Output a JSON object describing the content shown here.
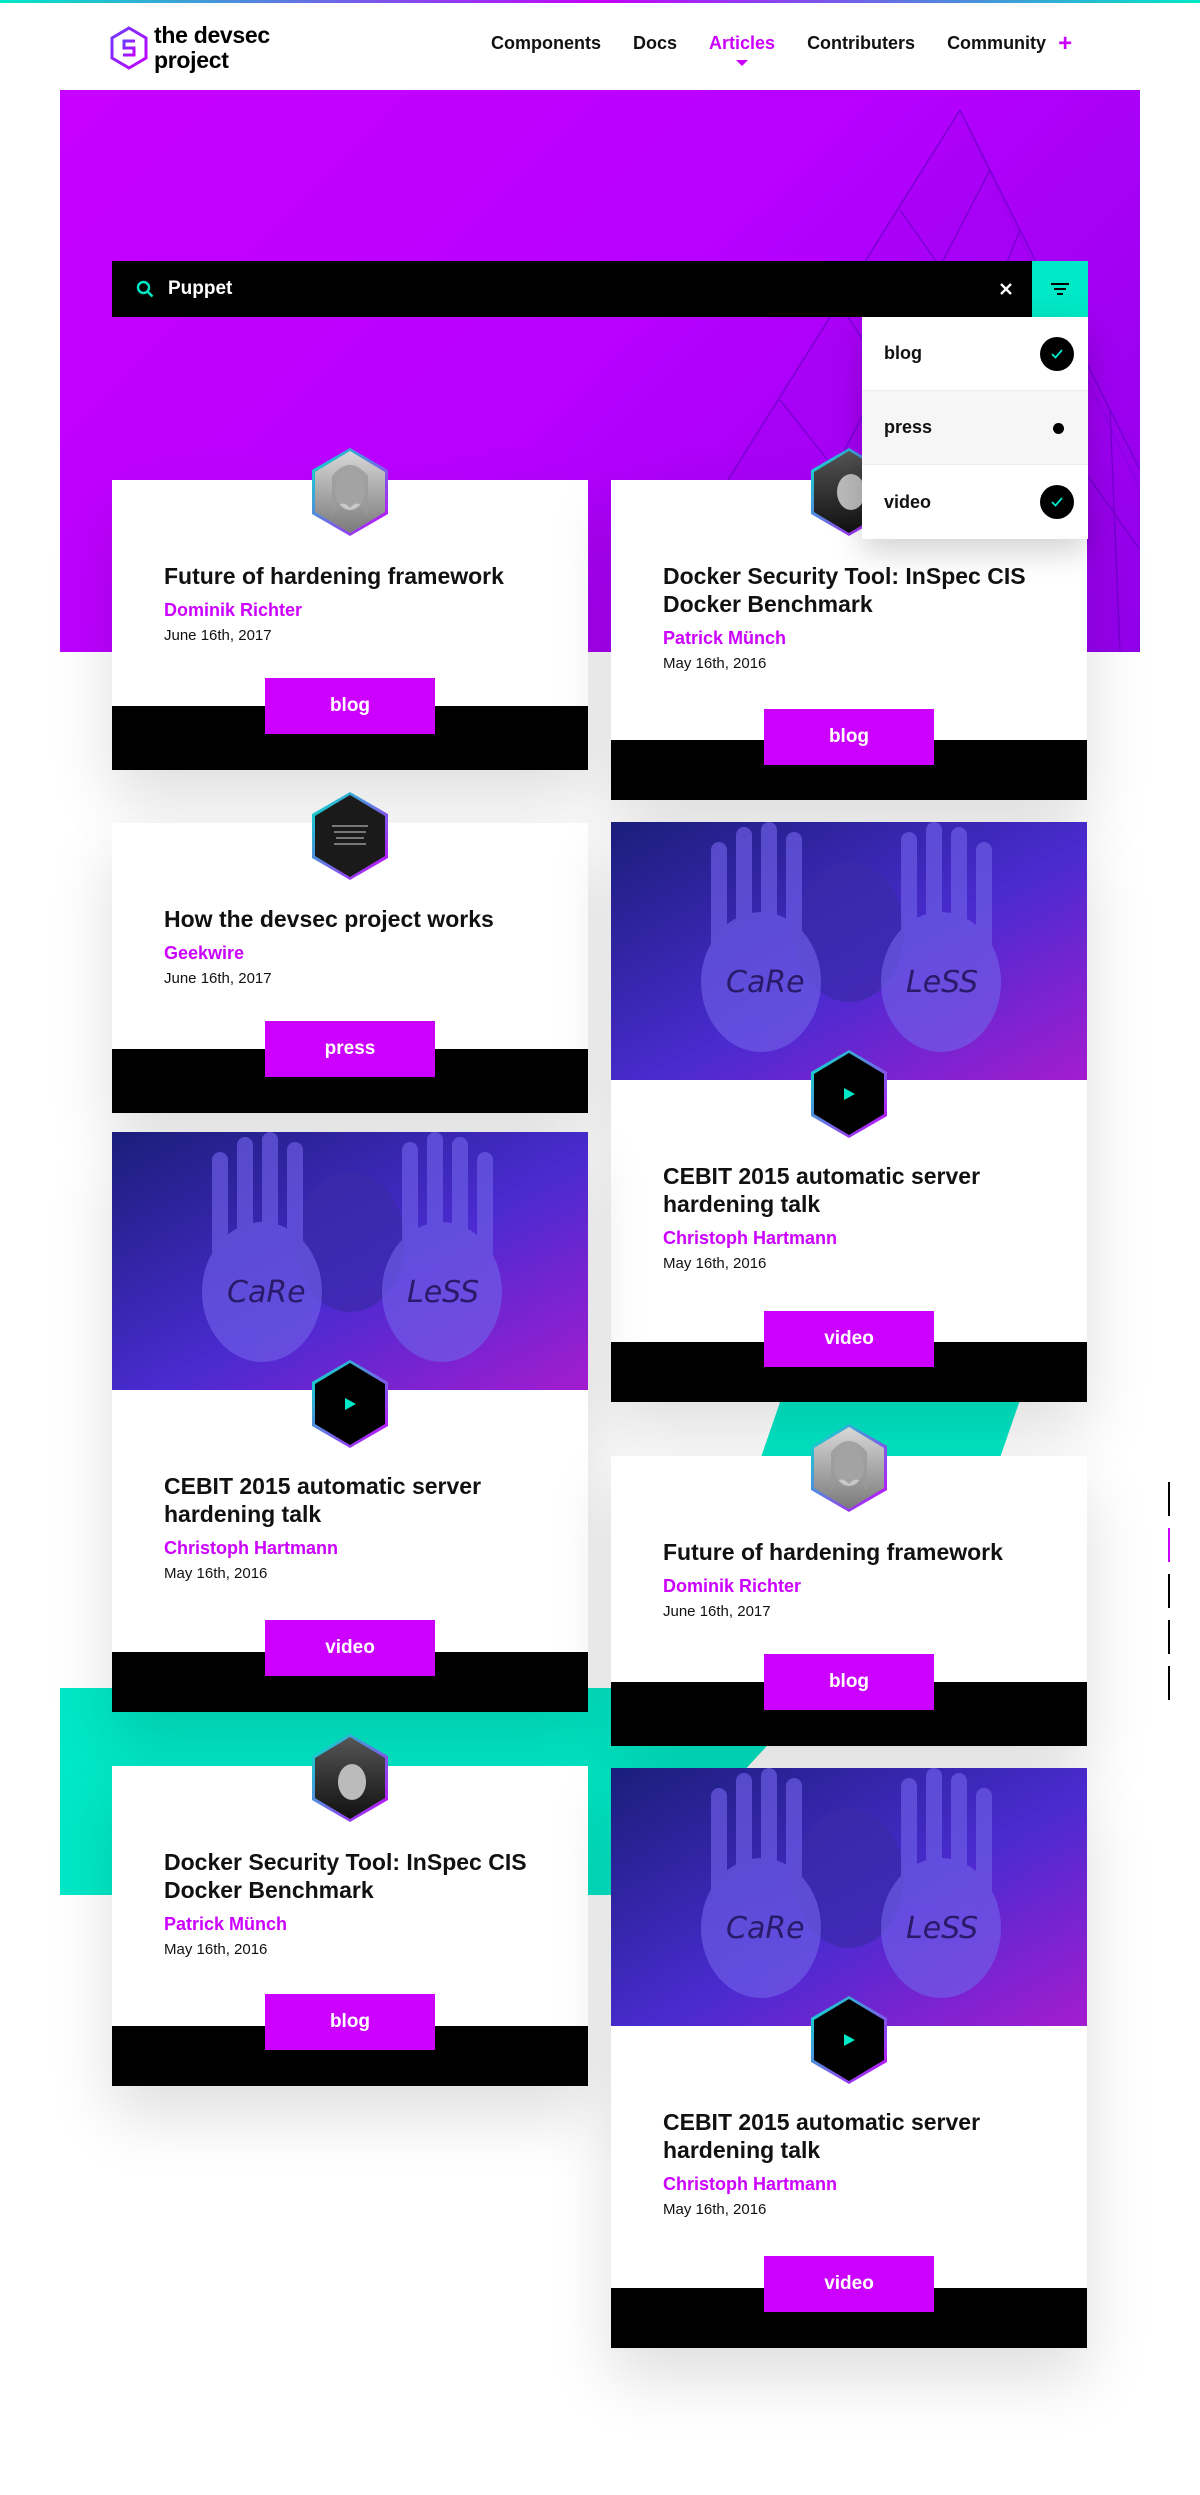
{
  "brand": {
    "name_line1": "the devsec",
    "name_line2": "project",
    "accent": "#cc00ff",
    "teal": "#00e8c6"
  },
  "nav": {
    "items": [
      "Components",
      "Docs",
      "Articles",
      "Contributers",
      "Community"
    ],
    "active": "Articles",
    "plus": "+"
  },
  "search": {
    "value": "Puppet",
    "icon": "search-icon",
    "clear_icon": "close-icon",
    "filter_icon": "filter-icon"
  },
  "filter_menu": {
    "items": [
      {
        "label": "blog",
        "checked": true
      },
      {
        "label": "press",
        "checked": false
      },
      {
        "label": "video",
        "checked": true
      }
    ]
  },
  "cards": [
    {
      "title": "Future of hardening framework",
      "author": "Dominik Richter",
      "date": "June 16th, 2017",
      "tag": "blog"
    },
    {
      "title": "Docker Security Tool: InSpec CIS Docker Benchmark",
      "author": "Patrick Münch",
      "date": "May 16th, 2016",
      "tag": "blog"
    },
    {
      "title": "How the devsec project works",
      "author": "Geekwire",
      "date": "June 16th, 2017",
      "tag": "press"
    },
    {
      "title": "CEBIT 2015 automatic server hardening talk",
      "author": "Christoph Hartmann",
      "date": "May 16th, 2016",
      "tag": "video",
      "image_text_left": "CaRe",
      "image_text_right": "LeSS"
    },
    {
      "title": "CEBIT 2015 automatic server hardening talk",
      "author": "Christoph Hartmann",
      "date": "May 16th, 2016",
      "tag": "video",
      "image_text_left": "CaRe",
      "image_text_right": "LeSS"
    },
    {
      "title": "Future of hardening framework",
      "author": "Dominik Richter",
      "date": "June 16th, 2017",
      "tag": "blog"
    },
    {
      "title": "Docker Security Tool: InSpec CIS Docker Benchmark",
      "author": "Patrick Münch",
      "date": "May 16th, 2016",
      "tag": "blog"
    },
    {
      "title": "CEBIT 2015 automatic server hardening talk",
      "author": "Christoph Hartmann",
      "date": "May 16th, 2016",
      "tag": "video",
      "image_text_left": "CaRe",
      "image_text_right": "LeSS"
    }
  ],
  "scroller": {
    "count": 5,
    "active_index": 1
  }
}
